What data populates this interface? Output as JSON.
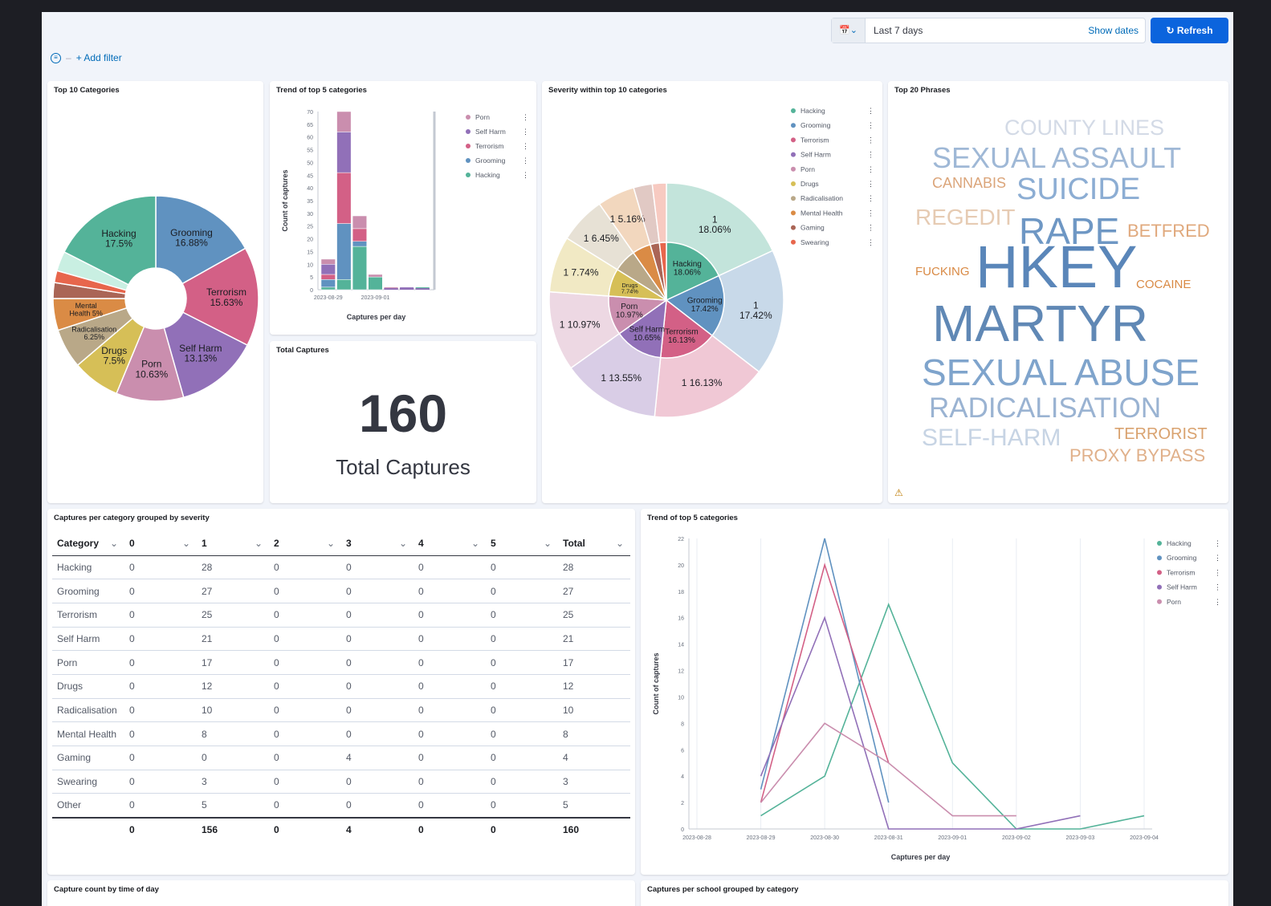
{
  "header": {
    "date_range": "Last 7 days",
    "show_dates": "Show dates",
    "refresh": "Refresh",
    "add_filter": "+ Add filter"
  },
  "panels": {
    "top10": "Top 10 Categories",
    "trend_bar": "Trend of top 5 categories",
    "severity": "Severity within top 10 categories",
    "phrases": "Top 20 Phrases",
    "total": "Total Captures",
    "table": "Captures per category grouped by severity",
    "trend_line": "Trend of top 5 categories",
    "time_of_day": "Capture count by time of day",
    "per_school": "Captures per school grouped by category"
  },
  "total_captures": {
    "value": "160",
    "label": "Total Captures"
  },
  "colors": {
    "Hacking": "#54b399",
    "Grooming": "#6092c0",
    "Terrorism": "#d36086",
    "Self Harm": "#9170b8",
    "Porn": "#ca8eae",
    "Drugs": "#d6bf57",
    "Radicalisation": "#b9a888",
    "Mental Health": "#da8b45",
    "Gaming": "#aa6556",
    "Swearing": "#e7664c",
    "Other": "#c9efe2"
  },
  "severity_legend": [
    "Hacking",
    "Grooming",
    "Terrorism",
    "Self Harm",
    "Porn",
    "Drugs",
    "Radicalisation",
    "Mental Health",
    "Gaming",
    "Swearing"
  ],
  "bar_legend": [
    "Porn",
    "Self Harm",
    "Terrorism",
    "Grooming",
    "Hacking"
  ],
  "line_legend": [
    "Hacking",
    "Grooming",
    "Terrorism",
    "Self Harm",
    "Porn"
  ],
  "chart_data": [
    {
      "type": "pie",
      "title": "Top 10 Categories",
      "labels": [
        "Grooming",
        "Terrorism",
        "Self Harm",
        "Porn",
        "Drugs",
        "Radicalisation",
        "Mental Health",
        "Gaming",
        "Swearing",
        "Other",
        "Hacking"
      ],
      "values": [
        27,
        25,
        21,
        17,
        12,
        10,
        8,
        4,
        3,
        5,
        28
      ],
      "slice_labels": [
        "Grooming\n16.88%",
        "Terrorism\n15.63%",
        "Self Harm\n13.13%",
        "Porn\n10.63%",
        "Drugs\n7.5%",
        "Radicalisation\n6.25%",
        "Mental\nHealth 5%",
        "",
        "",
        "",
        "Hacking\n17.5%"
      ]
    },
    {
      "type": "bar",
      "title": "Trend of top 5 categories",
      "xlabel": "Captures per day",
      "ylabel": "Count of captures",
      "ylim": [
        0,
        70
      ],
      "yticks": [
        0,
        5,
        10,
        15,
        20,
        25,
        30,
        35,
        40,
        45,
        50,
        55,
        60,
        65,
        70
      ],
      "x_ticks": [
        "2023-08-29",
        "2023-09-01"
      ],
      "days": [
        "2023-08-29",
        "2023-08-30",
        "2023-08-31",
        "2023-09-01",
        "2023-09-02",
        "2023-09-03",
        "2023-09-04"
      ],
      "series": [
        {
          "name": "Hacking",
          "values": [
            1,
            4,
            17,
            5,
            0,
            0,
            1
          ]
        },
        {
          "name": "Grooming",
          "values": [
            3,
            22,
            2,
            0,
            0,
            0,
            0
          ]
        },
        {
          "name": "Terrorism",
          "values": [
            2,
            20,
            5,
            0,
            0,
            0,
            0
          ]
        },
        {
          "name": "Self Harm",
          "values": [
            4,
            16,
            0,
            0,
            0,
            1,
            0
          ]
        },
        {
          "name": "Porn",
          "values": [
            2,
            8,
            5,
            1,
            1,
            0,
            0
          ]
        }
      ]
    },
    {
      "type": "pie",
      "title": "Severity within top 10 categories",
      "inner_labels": [
        "Hacking\n18.06%",
        "Grooming\n17.42%",
        "Terrorism\n16.13%",
        "Self Harm\n10.65%",
        "Porn\n10.97%",
        "Drugs\n7.74%",
        "",
        "",
        "",
        ""
      ],
      "inner_values": [
        28,
        27,
        25,
        21,
        17,
        12,
        10,
        8,
        4,
        3
      ],
      "outer_labels": [
        "1\n18.06%",
        "1\n17.42%",
        "1 16.13%",
        "1 13.55%",
        "1 10.97%",
        "1 7.74%",
        "1 6.45%",
        "1 5.16%",
        "",
        ""
      ]
    },
    {
      "type": "line",
      "title": "Trend of top 5 categories",
      "xlabel": "Captures per day",
      "ylabel": "Count of captures",
      "ylim": [
        0,
        22
      ],
      "yticks": [
        0,
        2,
        4,
        6,
        8,
        10,
        12,
        14,
        16,
        18,
        20,
        22
      ],
      "x_ticks": [
        "2023-08-28",
        "2023-08-29",
        "2023-08-30",
        "2023-08-31",
        "2023-09-01",
        "2023-09-02",
        "2023-09-03",
        "2023-09-04"
      ],
      "series": [
        {
          "name": "Hacking",
          "x": [
            "2023-08-29",
            "2023-08-30",
            "2023-08-31",
            "2023-09-01",
            "2023-09-02",
            "2023-09-03",
            "2023-09-04"
          ],
          "values": [
            1,
            4,
            17,
            5,
            0,
            0,
            1
          ]
        },
        {
          "name": "Grooming",
          "x": [
            "2023-08-29",
            "2023-08-30",
            "2023-08-31"
          ],
          "values": [
            3,
            22,
            2
          ]
        },
        {
          "name": "Terrorism",
          "x": [
            "2023-08-29",
            "2023-08-30",
            "2023-08-31"
          ],
          "values": [
            2,
            20,
            5
          ]
        },
        {
          "name": "Self Harm",
          "x": [
            "2023-08-29",
            "2023-08-30",
            "2023-08-31",
            "2023-09-01",
            "2023-09-02",
            "2023-09-03"
          ],
          "values": [
            4,
            16,
            0,
            0,
            0,
            1
          ]
        },
        {
          "name": "Porn",
          "x": [
            "2023-08-29",
            "2023-08-30",
            "2023-08-31",
            "2023-09-01",
            "2023-09-02"
          ],
          "values": [
            2,
            8,
            5,
            1,
            1
          ]
        }
      ]
    },
    {
      "type": "table",
      "title": "Captures per category grouped by severity",
      "columns": [
        "Category",
        "0",
        "1",
        "2",
        "3",
        "4",
        "5",
        "Total"
      ],
      "rows": [
        [
          "Hacking",
          "0",
          "28",
          "0",
          "0",
          "0",
          "0",
          "28"
        ],
        [
          "Grooming",
          "0",
          "27",
          "0",
          "0",
          "0",
          "0",
          "27"
        ],
        [
          "Terrorism",
          "0",
          "25",
          "0",
          "0",
          "0",
          "0",
          "25"
        ],
        [
          "Self Harm",
          "0",
          "21",
          "0",
          "0",
          "0",
          "0",
          "21"
        ],
        [
          "Porn",
          "0",
          "17",
          "0",
          "0",
          "0",
          "0",
          "17"
        ],
        [
          "Drugs",
          "0",
          "12",
          "0",
          "0",
          "0",
          "0",
          "12"
        ],
        [
          "Radicalisation",
          "0",
          "10",
          "0",
          "0",
          "0",
          "0",
          "10"
        ],
        [
          "Mental Health",
          "0",
          "8",
          "0",
          "0",
          "0",
          "0",
          "8"
        ],
        [
          "Gaming",
          "0",
          "0",
          "0",
          "4",
          "0",
          "0",
          "4"
        ],
        [
          "Swearing",
          "0",
          "3",
          "0",
          "0",
          "0",
          "0",
          "3"
        ],
        [
          "Other",
          "0",
          "5",
          "0",
          "0",
          "0",
          "0",
          "5"
        ]
      ],
      "footer": [
        "",
        "0",
        "156",
        "0",
        "4",
        "0",
        "0",
        "160"
      ]
    }
  ],
  "phrases": [
    {
      "text": "COUNTY LINES",
      "color": "#d3dae6"
    },
    {
      "text": "SEXUAL ASSAULT",
      "color": "#9fb8d6"
    },
    {
      "text": "CANNABIS",
      "color": "#dba57a"
    },
    {
      "text": "SUICIDE",
      "color": "#8cadd3"
    },
    {
      "text": "REGEDIT",
      "color": "#e6cbb3"
    },
    {
      "text": "RAPE",
      "color": "#6e97c4"
    },
    {
      "text": "BETFRED",
      "color": "#e0a97d"
    },
    {
      "text": "FUCKING",
      "color": "#d98a45"
    },
    {
      "text": "HKEY",
      "color": "#5a86b9"
    },
    {
      "text": "COCAINE",
      "color": "#d98a45"
    },
    {
      "text": "MARTYR",
      "color": "#6088b5"
    },
    {
      "text": "SEXUAL ABUSE",
      "color": "#7fa4cc"
    },
    {
      "text": "RADICALISATION",
      "color": "#9ab3d2"
    },
    {
      "text": "SELF-HARM",
      "color": "#c7d4e4"
    },
    {
      "text": "TERRORIST",
      "color": "#d9a26f"
    },
    {
      "text": "PROXY BYPASS",
      "color": "#e0b08a"
    }
  ]
}
